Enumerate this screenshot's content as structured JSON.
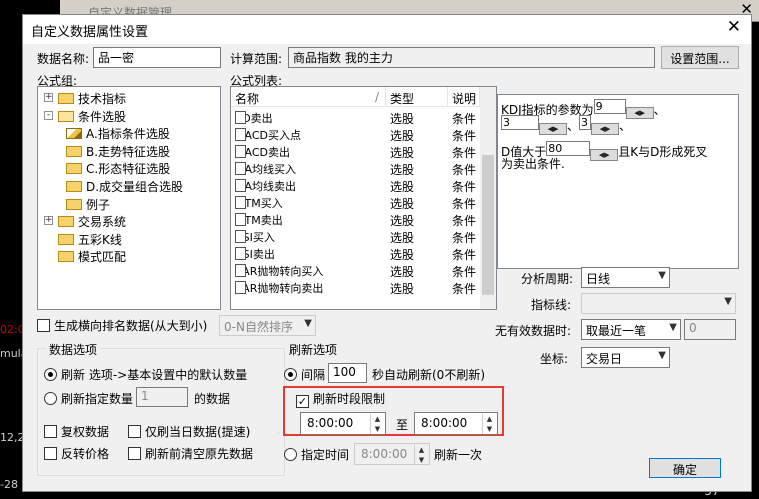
{
  "background": {
    "window_title": "自定义数据管理",
    "left_labels": [
      "02:0",
      "mula",
      "12,2",
      "-28"
    ],
    "right_labels": [
      "-57"
    ]
  },
  "dialog": {
    "title": "自定义数据属性设置",
    "close_glyph": "✕",
    "data_name_label": "数据名称:",
    "data_name_value": "品一密",
    "calc_range_label": "计算范围:",
    "calc_range_value": "商品指数  我的主力",
    "set_range_button": "设置范围...",
    "formula_group_label": "公式组:",
    "formula_list_label": "公式列表:",
    "tree": [
      {
        "label": "技术指标",
        "level": 0,
        "toggle": "+",
        "icon": "folder"
      },
      {
        "label": "条件选股",
        "level": 0,
        "toggle": "-",
        "icon": "folder-open"
      },
      {
        "label": "A.指标条件选股",
        "level": 1,
        "toggle": "",
        "icon": "pencil"
      },
      {
        "label": "B.走势特征选股",
        "level": 1,
        "toggle": "",
        "icon": "folder"
      },
      {
        "label": "C.形态特征选股",
        "level": 1,
        "toggle": "",
        "icon": "folder"
      },
      {
        "label": "D.成交量组合选股",
        "level": 1,
        "toggle": "",
        "icon": "folder"
      },
      {
        "label": "例子",
        "level": 1,
        "toggle": "",
        "icon": "folder"
      },
      {
        "label": "交易系统",
        "level": 0,
        "toggle": "+",
        "icon": "folder"
      },
      {
        "label": "五彩K线",
        "level": 0,
        "toggle": "",
        "icon": "folder"
      },
      {
        "label": "模式匹配",
        "level": 0,
        "toggle": "",
        "icon": "folder"
      }
    ],
    "list_headers": {
      "name": "名称",
      "type": "类型",
      "desc": "说明"
    },
    "list_rows": [
      {
        "name": "KD卖出",
        "type": "选股",
        "desc": "条件"
      },
      {
        "name": "MACD买入点",
        "type": "选股",
        "desc": "条件"
      },
      {
        "name": "MACD卖出",
        "type": "选股",
        "desc": "条件"
      },
      {
        "name": "MA均线买入",
        "type": "选股",
        "desc": "条件"
      },
      {
        "name": "MA均线卖出",
        "type": "选股",
        "desc": "条件"
      },
      {
        "name": "MTM买入",
        "type": "选股",
        "desc": "条件"
      },
      {
        "name": "MTM卖出",
        "type": "选股",
        "desc": "条件"
      },
      {
        "name": "RSI买入",
        "type": "选股",
        "desc": "条件"
      },
      {
        "name": "RSI卖出",
        "type": "选股",
        "desc": "条件"
      },
      {
        "name": "SAR抛物转向买入",
        "type": "选股",
        "desc": "条件"
      },
      {
        "name": "SAR抛物转向卖出",
        "type": "选股",
        "desc": "条件"
      }
    ],
    "params": {
      "line1_text": "KDJ指标的参数为",
      "p1": "9",
      "sep": "、",
      "p2": "3",
      "p3": "3",
      "line4_a": "D值大于",
      "p4": "80",
      "line4_b": "且K与D形成死叉",
      "line5": "为卖出条件."
    },
    "analysis_period_label": "分析周期:",
    "analysis_period_value": "日线",
    "indicator_line_label": "指标线:",
    "indicator_line_value": "",
    "invalid_data_label": "无有效数据时:",
    "invalid_data_value": "取最近一笔",
    "invalid_data_number": "0",
    "axis_label": "坐标:",
    "axis_value": "交易日",
    "rank_checkbox_label": "生成横向排名数据(从大到小)",
    "rank_combo_value": "0-N自然排序",
    "data_options": {
      "title": "数据选项",
      "refresh_label": "刷新 选项->基本设置中的默认数量",
      "refresh_count_label": "刷新指定数量",
      "refresh_count_value": "1",
      "refresh_count_suffix": "的数据",
      "restore_label": "复权数据",
      "refresh_today_label": "仅刷当日数据(提速)",
      "reverse_label": "反转价格",
      "clear_before_label": "刷新前清空原先数据"
    },
    "refresh_options": {
      "title": "刷新选项",
      "interval_label": "间隔",
      "interval_value": "100",
      "interval_suffix": "秒自动刷新(0不刷新)",
      "time_limit_label": "刷新时段限制",
      "time_from": "8:00:00",
      "to_label": "至",
      "time_to": "8:00:00",
      "specified_time_label": "指定时间",
      "specified_time_value": "8:00:00",
      "refresh_once_label": "刷新一次"
    },
    "ok_button": "确定"
  },
  "colors": {
    "highlight_box": "#e53935",
    "background": "#000000",
    "dialog_bg": "#f0f0f0"
  }
}
